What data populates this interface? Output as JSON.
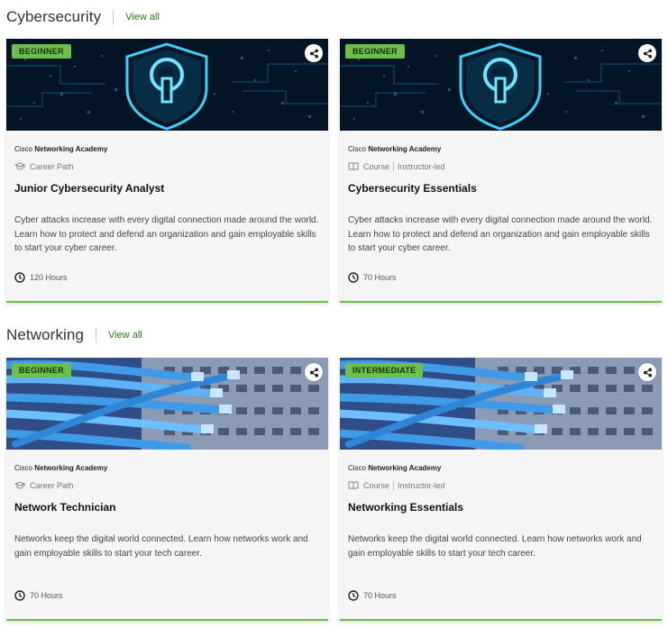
{
  "sections": [
    {
      "title": "Cybersecurity",
      "view_all": "View all",
      "cards": [
        {
          "badge": "BEGINNER",
          "image": "cyber-shield-lock",
          "provider_prefix": "Cisco",
          "provider_name": "Networking Academy",
          "type": "Career Path",
          "delivery": "",
          "type_icon": "graduation-cap-icon",
          "title": "Junior Cybersecurity Analyst",
          "description": "Cyber attacks increase with every digital connection made around the world. Learn how to protect and defend an organization and gain employable skills to start your cyber career.",
          "hours": "120 Hours"
        },
        {
          "badge": "BEGINNER",
          "image": "cyber-shield-lock",
          "provider_prefix": "Cisco",
          "provider_name": "Networking Academy",
          "type": "Course",
          "delivery": "Instructor-led",
          "type_icon": "book-icon",
          "title": "Cybersecurity Essentials",
          "description": "Cyber attacks increase with every digital connection made around the world. Learn how to protect and defend an organization and gain employable skills to start your cyber career.",
          "hours": "70 Hours"
        }
      ]
    },
    {
      "title": "Networking",
      "view_all": "View all",
      "cards": [
        {
          "badge": "BEGINNER",
          "image": "network-cables",
          "provider_prefix": "Cisco",
          "provider_name": "Networking Academy",
          "type": "Career Path",
          "delivery": "",
          "type_icon": "graduation-cap-icon",
          "title": "Network Technician",
          "description": "Networks keep the digital world connected. Learn how networks work and gain employable skills to start your tech career.",
          "hours": "70 Hours"
        },
        {
          "badge": "INTERMEDIATE",
          "image": "network-cables",
          "provider_prefix": "Cisco",
          "provider_name": "Networking Academy",
          "type": "Course",
          "delivery": "Instructor-led",
          "type_icon": "book-icon",
          "title": "Networking Essentials",
          "description": "Networks keep the digital world connected. Learn how networks work and gain employable skills to start your tech career.",
          "hours": "70 Hours"
        }
      ]
    }
  ],
  "colors": {
    "accent_green": "#6cc04a",
    "link_green": "#2c7a16",
    "card_bg": "#f5f5f5"
  }
}
